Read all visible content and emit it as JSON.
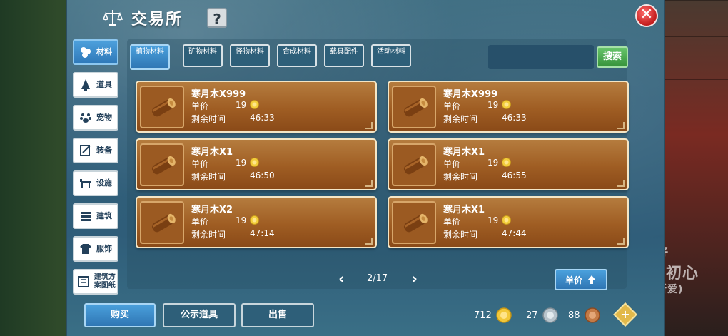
{
  "header": {
    "title": "交易所",
    "help_label": "?",
    "close_label": "✕"
  },
  "sidebar": {
    "items": [
      {
        "label": "材料",
        "icon": "materials-icon",
        "active": true
      },
      {
        "label": "道具",
        "icon": "props-icon",
        "active": false
      },
      {
        "label": "宠物",
        "icon": "pet-icon",
        "active": false
      },
      {
        "label": "装备",
        "icon": "equipment-icon",
        "active": false
      },
      {
        "label": "设施",
        "icon": "facility-icon",
        "active": false
      },
      {
        "label": "建筑",
        "icon": "building-icon",
        "active": false
      },
      {
        "label": "服饰",
        "icon": "clothing-icon",
        "active": false
      },
      {
        "label": "建筑方案图纸",
        "icon": "blueprint-icon",
        "active": false
      }
    ]
  },
  "tabs": [
    {
      "label": "植物材料",
      "active": true
    },
    {
      "label": "矿物材料",
      "active": false
    },
    {
      "label": "怪物材料",
      "active": false
    },
    {
      "label": "合成材料",
      "active": false
    },
    {
      "label": "载具配件",
      "active": false
    },
    {
      "label": "活动材料",
      "active": false
    }
  ],
  "search": {
    "value": "",
    "button_label": "搜索"
  },
  "listing_labels": {
    "price": "单价",
    "time": "剩余时间"
  },
  "listings": [
    {
      "name": "寒月木X999",
      "price": "19",
      "time": "46:33"
    },
    {
      "name": "寒月木X999",
      "price": "19",
      "time": "46:33"
    },
    {
      "name": "寒月木X1",
      "price": "19",
      "time": "46:50"
    },
    {
      "name": "寒月木X1",
      "price": "19",
      "time": "46:55"
    },
    {
      "name": "寒月木X2",
      "price": "19",
      "time": "47:14"
    },
    {
      "name": "寒月木X1",
      "price": "19",
      "time": "47:44"
    }
  ],
  "pagination": {
    "text": "2/17",
    "prev_label": "‹",
    "next_label": "›"
  },
  "sort": {
    "label": "单价"
  },
  "bottom": {
    "buy_label": "购买",
    "public_label": "公示道具",
    "sell_label": "出售"
  },
  "currencies": [
    {
      "amount": "712",
      "icon": "gold-coin-icon",
      "color": "#e8c23a"
    },
    {
      "amount": "27",
      "icon": "silver-coin-icon",
      "color": "#b8c4cc"
    },
    {
      "amount": "88",
      "icon": "copper-coin-icon",
      "color": "#c47a45"
    }
  ],
  "colors": {
    "accent_blue": "#2f79b9",
    "card_brown": "#9f5d23",
    "search_green": "#37933c",
    "close_red": "#c31d1d"
  },
  "background_text": {
    "line1": "好",
    "line2": "忘初心",
    "line3": "所爱)"
  }
}
